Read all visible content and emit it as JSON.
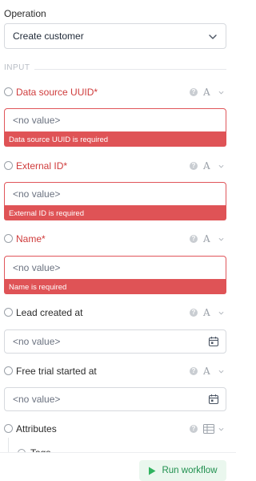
{
  "operation": {
    "label": "Operation",
    "selected": "Create customer",
    "chevron_icon": "chevron-down-icon"
  },
  "section": {
    "input_label": "INPUT"
  },
  "fields": [
    {
      "label": "Data source UUID*",
      "required": true,
      "value_placeholder": "<no value>",
      "error": "Data source UUID is required",
      "type_glyph": "A"
    },
    {
      "label": "External ID*",
      "required": true,
      "value_placeholder": "<no value>",
      "error": "External ID is required",
      "type_glyph": "A"
    },
    {
      "label": "Name*",
      "required": true,
      "value_placeholder": "<no value>",
      "error": "Name is required",
      "type_glyph": "A"
    },
    {
      "label": "Lead created at",
      "required": false,
      "value_placeholder": "<no value>",
      "type_glyph": "A",
      "icon": "calendar-icon"
    },
    {
      "label": "Free trial started at",
      "required": false,
      "value_placeholder": "<no value>",
      "type_glyph": "A",
      "icon": "calendar-icon"
    },
    {
      "label": "Attributes",
      "required": false,
      "icon": "table-icon"
    }
  ],
  "sub_fields": [
    {
      "label": "Tags"
    }
  ],
  "footer": {
    "run_label": "Run workflow",
    "run_icon": "play-icon"
  },
  "colors": {
    "error": "#df5356",
    "required_label": "#cf3b3b",
    "run_button_bg": "#eaf7ee",
    "run_button_text": "#1f8f4e"
  }
}
